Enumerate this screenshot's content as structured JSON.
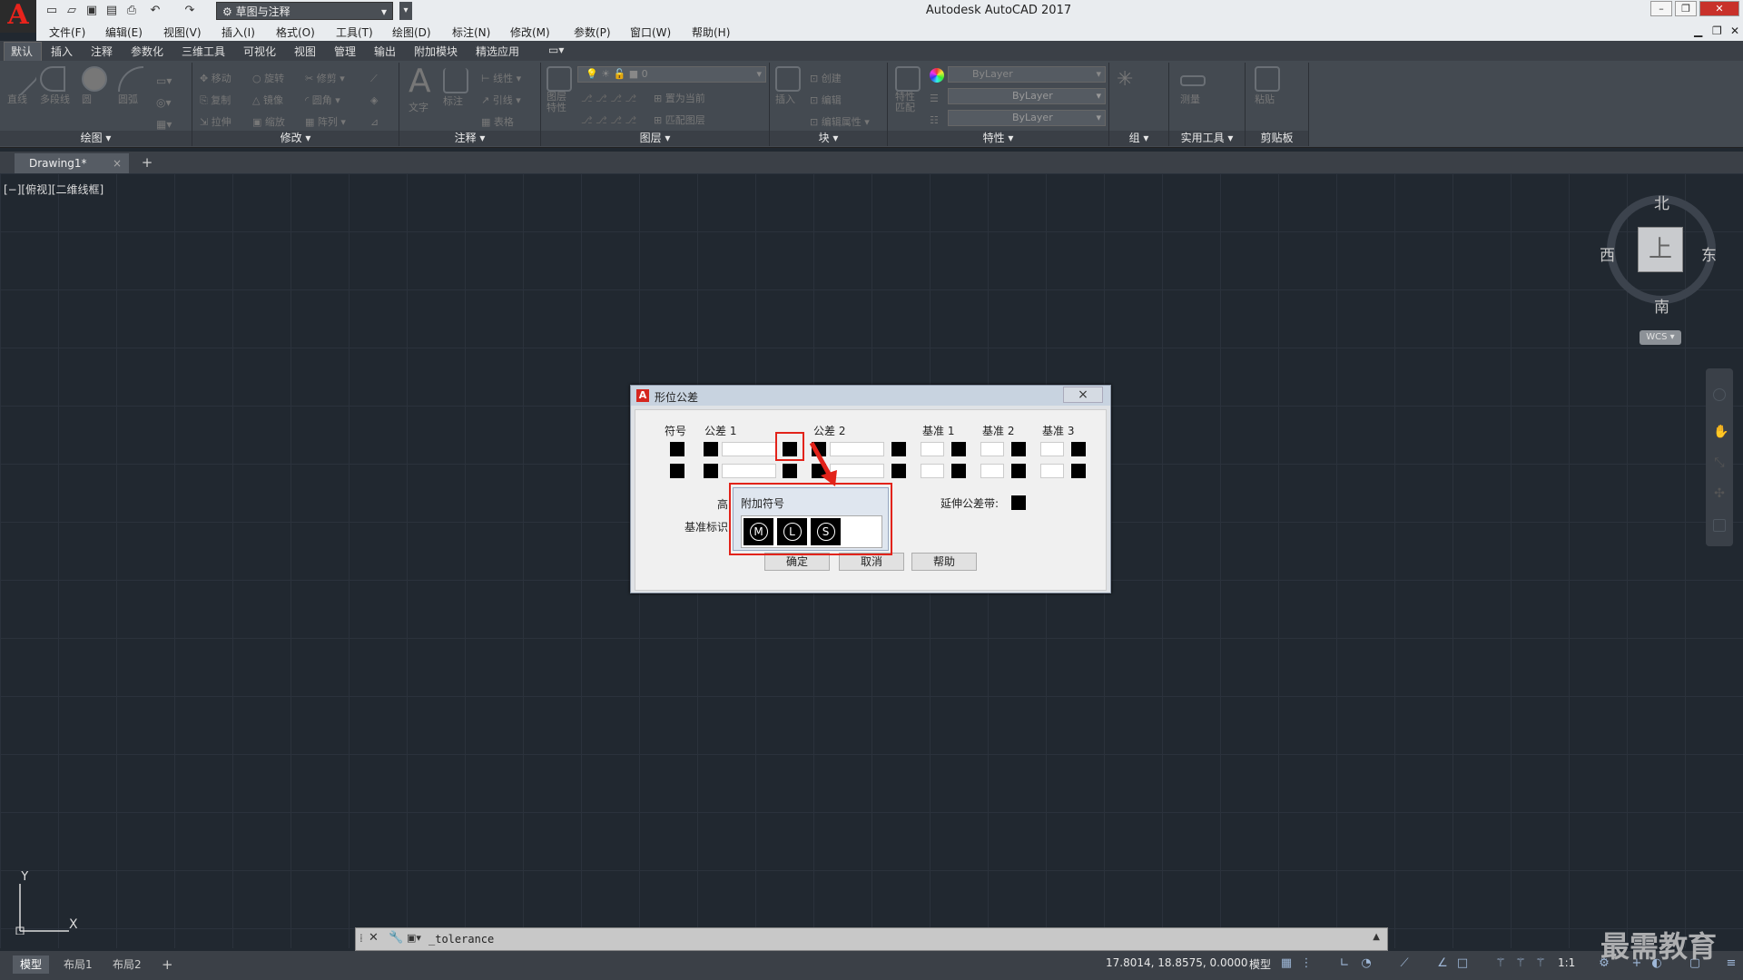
{
  "app": {
    "title": "Autodesk AutoCAD 2017",
    "logo": "A",
    "workspace": "草图与注释"
  },
  "menu": [
    "文件(F)",
    "编辑(E)",
    "视图(V)",
    "插入(I)",
    "格式(O)",
    "工具(T)",
    "绘图(D)",
    "标注(N)",
    "修改(M)",
    "参数(P)",
    "窗口(W)",
    "帮助(H)"
  ],
  "ribbon_tabs": [
    "默认",
    "插入",
    "注释",
    "参数化",
    "三维工具",
    "可视化",
    "视图",
    "管理",
    "输出",
    "附加模块",
    "精选应用"
  ],
  "ribbon": {
    "panels": [
      "绘图 ▾",
      "修改 ▾",
      "注释 ▾",
      "图层 ▾",
      "块 ▾",
      "特性 ▾",
      "组 ▾",
      "实用工具 ▾",
      "剪贴板"
    ],
    "draw_tools": [
      "直线",
      "多段线",
      "圆",
      "圆弧"
    ],
    "modify_tools": [
      [
        "移动",
        "旋转",
        "修剪"
      ],
      [
        "复制",
        "镜像",
        "圆角"
      ],
      [
        "拉伸",
        "缩放",
        "阵列"
      ]
    ],
    "annot_tools": [
      "文字",
      "标注",
      "线性",
      "引线",
      "表格"
    ],
    "layer_tools": [
      "图层特性",
      "置为当前",
      "匹配图层"
    ],
    "layer_current": "0",
    "block_tools": [
      "插入",
      "创建",
      "编辑",
      "编辑属性"
    ],
    "prop_tools": [
      "特性匹配"
    ],
    "bylayer": [
      "ByLayer",
      "ByLayer",
      "ByLayer"
    ],
    "util_tools": [
      "测量"
    ],
    "clip_tools": [
      "粘贴"
    ]
  },
  "document_tab": "Drawing1*",
  "view_label": "[−][俯视][二维线框]",
  "viewcube": {
    "north": "北",
    "south": "南",
    "east": "东",
    "west": "西",
    "top": "上",
    "wcs": "WCS"
  },
  "dialog": {
    "title": "形位公差",
    "headers": {
      "symbol": "符号",
      "tol1": "公差 1",
      "tol2": "公差 2",
      "datum1": "基准 1",
      "datum2": "基准 2",
      "datum3": "基准 3"
    },
    "height_label": "高",
    "datum_id_label": "基准标识",
    "projected_label": "延伸公差带:",
    "ok": "确定",
    "cancel": "取消",
    "help": "帮助",
    "close_icon": "×"
  },
  "material_dialog": {
    "title": "附加符号",
    "symbols": [
      "M",
      "L",
      "S"
    ]
  },
  "command_line": "_tolerance",
  "layouts": [
    "模型",
    "布局1",
    "布局2"
  ],
  "status": {
    "coords": "17.8014, 18.8575, 0.0000",
    "model": "模型",
    "scale": "1:1"
  },
  "watermark": "最需教育",
  "ucs": {
    "x": "X",
    "y": "Y"
  },
  "colors": {
    "accent": "#e2231a",
    "canvas": "#212830"
  }
}
